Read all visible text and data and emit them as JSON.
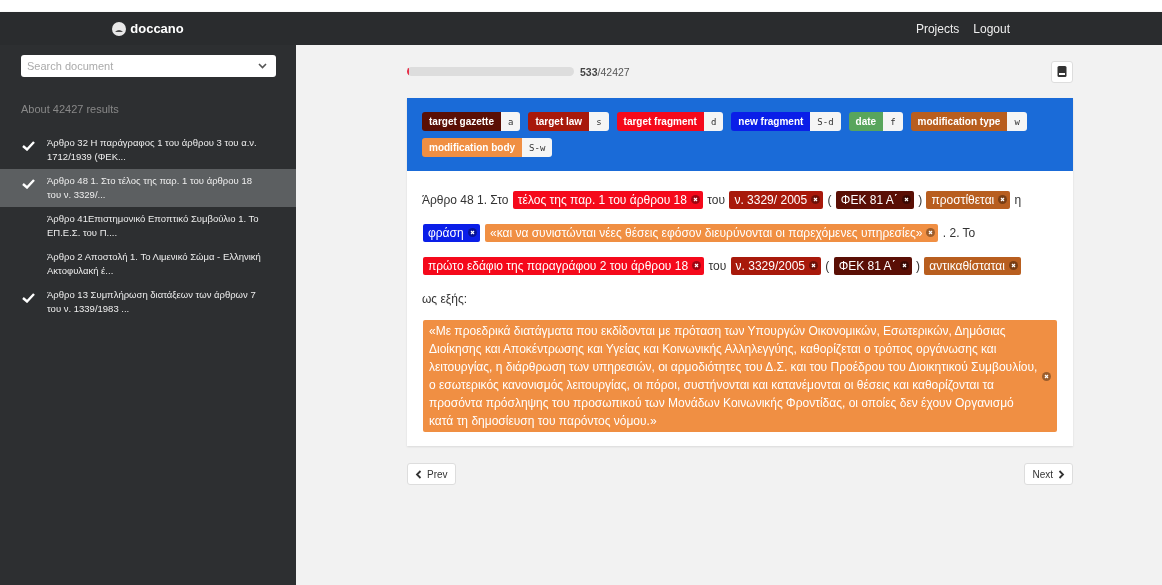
{
  "navbar": {
    "brand": "doccano",
    "links": [
      "Projects",
      "Logout"
    ]
  },
  "sidebar": {
    "search": {
      "placeholder": "Search document"
    },
    "result_count": "About 42427 results",
    "items": [
      {
        "text": "Άρθρο 32 Η παράγραφος 1 του άρθρου 3 του α.ν. 1712/1939 (ΦΕΚ...",
        "checked": true,
        "selected": false
      },
      {
        "text": "Άρθρο 48 1. Στο τέλος της παρ. 1 του άρθρου 18 του ν. 3329/...",
        "checked": true,
        "selected": true
      },
      {
        "text": "Άρθρο 41Επιστημονικό Εποπτικό Συμβούλιο 1. Το ΕΠ.Ε.Σ. του Π....",
        "checked": false,
        "selected": false
      },
      {
        "text": "Άρθρο 2 Αποστολή 1. Το Λιμενικό Σώμα - Ελληνική Ακτοφυλακή έ...",
        "checked": false,
        "selected": false
      },
      {
        "text": "Άρθρο 13 Συμπλήρωση διατάξεων των άρθρων 7 του ν. 1339/1983 ...",
        "checked": true,
        "selected": false
      }
    ]
  },
  "progress": {
    "level": 0.0126,
    "done": "533",
    "total": "/42427"
  },
  "labels": [
    {
      "name": "target gazette",
      "shortcut": "a",
      "color": "#5a0f05"
    },
    {
      "name": "target law",
      "shortcut": "s",
      "color": "#a8190b"
    },
    {
      "name": "target fragment",
      "shortcut": "d",
      "color": "#f5091b"
    },
    {
      "name": "new fragment",
      "shortcut": "S-d",
      "color": "#0a1ee8"
    },
    {
      "name": "date",
      "shortcut": "f",
      "color": "#58a55c"
    },
    {
      "name": "modification type",
      "shortcut": "w",
      "color": "#b85e1f"
    },
    {
      "name": "modification body",
      "shortcut": "S-w",
      "color": "#f08f43"
    }
  ],
  "document": [
    {
      "kind": "plain",
      "text": "Άρθρο 48 1. Στο"
    },
    {
      "kind": "entity",
      "text": "τέλος της παρ. 1 του άρθρου 18",
      "color": "#f5091b"
    },
    {
      "kind": "plain",
      "text": "του"
    },
    {
      "kind": "entity",
      "text": "ν.  3329/ 2005",
      "color": "#a8190b"
    },
    {
      "kind": "plain",
      "text": "("
    },
    {
      "kind": "entity",
      "text": "ΦΕΚ 81 Α΄",
      "color": "#5a0f05"
    },
    {
      "kind": "plain",
      "text": ")"
    },
    {
      "kind": "entity",
      "text": "προστίθεται",
      "color": "#b85e1f"
    },
    {
      "kind": "plain",
      "text": "η"
    },
    {
      "kind": "entity",
      "text": "φράση",
      "color": "#0a1ee8"
    },
    {
      "kind": "entity",
      "text": "«και να συνιστώνται νέες θέσεις εφόσον διευρύνονται οι παρεχόμενες υπηρεσίες»",
      "color": "#f08f43"
    },
    {
      "kind": "plain",
      "text": ". 2. Το"
    },
    {
      "kind": "entity",
      "text": "πρώτο εδάφιο της παραγράφου 2 του άρθρου 18",
      "color": "#f5091b"
    },
    {
      "kind": "plain",
      "text": "του"
    },
    {
      "kind": "entity",
      "text": "ν.  3329/2005",
      "color": "#a8190b"
    },
    {
      "kind": "plain",
      "text": "("
    },
    {
      "kind": "entity",
      "text": "ΦΕΚ 81 Α΄",
      "color": "#5a0f05"
    },
    {
      "kind": "plain",
      "text": ")"
    },
    {
      "kind": "entity",
      "text": "αντικαθίσταται",
      "color": "#b85e1f"
    },
    {
      "kind": "plain",
      "text": "ως εξής:"
    },
    {
      "kind": "block",
      "text": "«Με προεδρικά διατάγματα που εκδίδονται με πρόταση των Υπουργών Οικονομικών, Εσωτερικών, Δημόσιας Διοίκησης και Αποκέντρωσης και Υγείας και Κοινωνικής Αλληλεγγύης, καθορίζεται ο τρόπος οργάνωσης και λειτουργίας, η διάρθρωση των υπηρεσιών, οι αρμοδιότητες του Δ.Σ. και του Προέδρου του Διοικητικού Συμβουλίου, ο εσωτερικός κανονισμός λειτουργίας, οι πόροι, συστήνονται και κατανέμονται οι θέσεις και καθορίζονται τα προσόντα πρόσληψης του προσωπικού των Μονάδων Κοινωνικής Φροντίδας, οι οποίες δεν έχουν Οργανισμό κατά τη δημοσίευση του παρόντος νόμου.»",
      "color": "#f08f43"
    }
  ],
  "pager": {
    "prev": "Prev",
    "next": "Next"
  }
}
